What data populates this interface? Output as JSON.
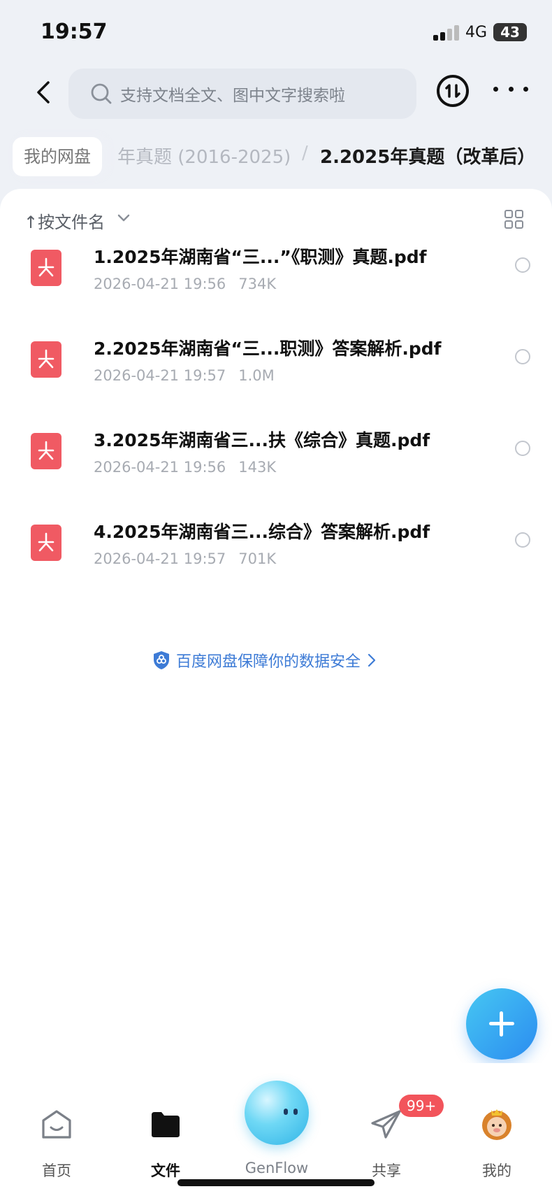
{
  "status_bar": {
    "time": "19:57",
    "network": "4G",
    "battery": "43"
  },
  "header": {
    "search_placeholder": "支持文档全文、图中文字搜索啦"
  },
  "breadcrumb": {
    "home": "我的网盘",
    "middle": "年真题 (2016-2025)",
    "separator": "/",
    "current": "2.2025年真题（改革后）"
  },
  "toolbar": {
    "sort_label": "↑按文件名"
  },
  "files": [
    {
      "name": "1.2025年湖南省“三...”《职测》真题.pdf",
      "date": "2026-04-21 19:56",
      "size": "734K"
    },
    {
      "name": "2.2025年湖南省“三...职测》答案解析.pdf",
      "date": "2026-04-21 19:57",
      "size": "1.0M"
    },
    {
      "name": "3.2025年湖南省三...扶《综合》真题.pdf",
      "date": "2026-04-21 19:56",
      "size": "143K"
    },
    {
      "name": "4.2025年湖南省三...综合》答案解析.pdf",
      "date": "2026-04-21 19:57",
      "size": "701K"
    }
  ],
  "security_notice": "百度网盘保障你的数据安全",
  "tabbar": {
    "home": "首页",
    "files": "文件",
    "genflow": "GenFlow",
    "share": "共享",
    "share_badge": "99+",
    "mine": "我的"
  },
  "colors": {
    "accent": "#3d7bd6",
    "pdf": "#f05a63",
    "badge": "#f2545b"
  }
}
